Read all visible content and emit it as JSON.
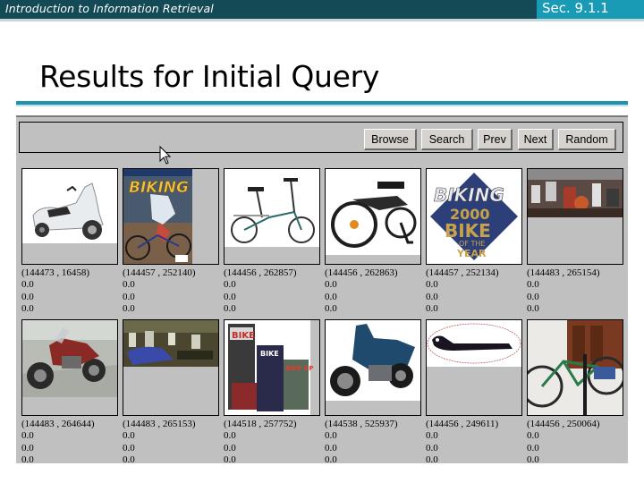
{
  "header": {
    "course_title": "Introduction to Information Retrieval",
    "section": "Sec. 9.1.1"
  },
  "slide": {
    "title": "Results for Initial Query"
  },
  "toolbar": {
    "buttons": [
      {
        "label": "Browse"
      },
      {
        "label": "Search"
      },
      {
        "label": "Prev"
      },
      {
        "label": "Next"
      },
      {
        "label": "Random"
      }
    ]
  },
  "results": [
    {
      "id": "(144473 , 16458)",
      "scores": [
        "0.0",
        "0.0",
        "0.0"
      ],
      "image": "white scooter"
    },
    {
      "id": "(144457 , 252140)",
      "scores": [
        "0.0",
        "0.0",
        "0.0"
      ],
      "image": "Biking magazine cover"
    },
    {
      "id": "(144456 , 262857)",
      "scores": [
        "0.0",
        "0.0",
        "0.0"
      ],
      "image": "folding bicycle"
    },
    {
      "id": "(144456 , 262863)",
      "scores": [
        "0.0",
        "0.0",
        "0.0"
      ],
      "image": "folded bicycle"
    },
    {
      "id": "(144457 , 252134)",
      "scores": [
        "0.0",
        "0.0",
        "0.0"
      ],
      "image": "Biking 2000 Bike of the Year logo"
    },
    {
      "id": "(144483 , 265154)",
      "scores": [
        "0.0",
        "0.0",
        "0.0"
      ],
      "image": "motorcycle showroom"
    },
    {
      "id": "(144483 , 264644)",
      "scores": [
        "0.0",
        "0.0",
        "0.0"
      ],
      "image": "red motorcycle"
    },
    {
      "id": "(144483 , 265153)",
      "scores": [
        "0.0",
        "0.0",
        "0.0"
      ],
      "image": "motorcycle showroom blue"
    },
    {
      "id": "(144518 , 257752)",
      "scores": [
        "0.0",
        "0.0",
        "0.0"
      ],
      "image": "Bike GP magazines"
    },
    {
      "id": "(144538 , 525937)",
      "scores": [
        "0.0",
        "0.0",
        "0.0"
      ],
      "image": "blue touring motorcycle"
    },
    {
      "id": "(144456 , 249611)",
      "scores": [
        "0.0",
        "0.0",
        "0.0"
      ],
      "image": "black bracket part"
    },
    {
      "id": "(144456 , 250064)",
      "scores": [
        "0.0",
        "0.0",
        "0.0"
      ],
      "image": "green mountain bike on stand"
    }
  ]
}
